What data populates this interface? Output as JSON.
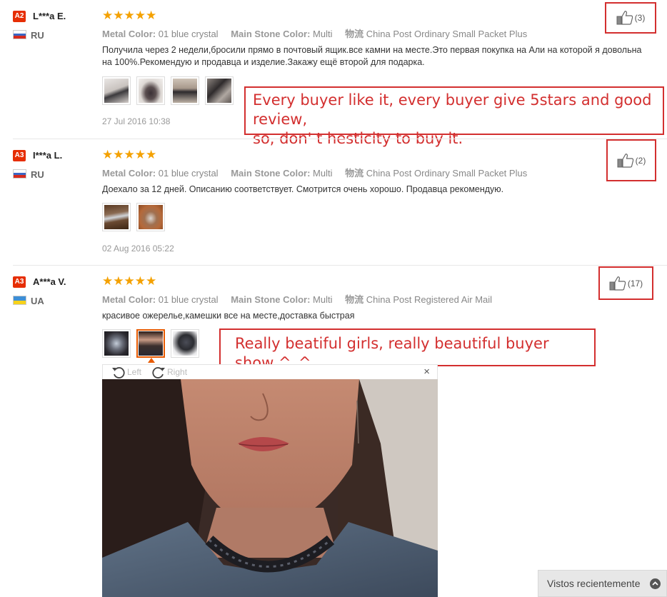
{
  "reviews": [
    {
      "level": "A2",
      "name": "L***a E.",
      "country": "RU",
      "stars": "★★★★★",
      "metal_label": "Metal Color:",
      "metal_value": "01 blue crystal",
      "stone_label": "Main Stone Color:",
      "stone_value": "Multi",
      "ship_label": "物流",
      "ship_value": "China Post Ordinary Small Packet Plus",
      "text": "Получила через 2 недели,бросили прямо в почтовый ящик.все камни на месте.Это первая покупка на Али на которой я довольна на 100%.Рекомендую и продавца и изделие.Закажу ещё второй для подарка.",
      "date": "27 Jul 2016 10:38",
      "likes": "(3)"
    },
    {
      "level": "A3",
      "name": "I***a L.",
      "country": "RU",
      "stars": "★★★★★",
      "metal_label": "Metal Color:",
      "metal_value": "01 blue crystal",
      "stone_label": "Main Stone Color:",
      "stone_value": "Multi",
      "ship_label": "物流",
      "ship_value": "China Post Ordinary Small Packet Plus",
      "text": "Доехало за 12 дней. Описанию соответствует. Смотрится очень хорошо. Продавца рекомендую.",
      "date": "02 Aug 2016 05:22",
      "likes": "(2)"
    },
    {
      "level": "A3",
      "name": "A***a V.",
      "country": "UA",
      "stars": "★★★★★",
      "metal_label": "Metal Color:",
      "metal_value": "01 blue crystal",
      "stone_label": "Main Stone Color:",
      "stone_value": "Multi",
      "ship_label": "物流",
      "ship_value": "China Post Registered Air Mail",
      "text": "красивое ожерелье,камешки все на месте,доставка быстрая",
      "likes": "(17)"
    }
  ],
  "callouts": {
    "first_line1": "Every buyer like it, every buyer give 5stars and good review,",
    "first_line2": "so, don' t hesticity to buy it.",
    "second": "Really beatiful girls, really beautiful buyer show ^_^"
  },
  "viewer": {
    "left_label": "Left",
    "right_label": "Right",
    "close": "×"
  },
  "recent": {
    "label": "Vistos recientemente"
  },
  "colors": {
    "accent": "#e62e04",
    "star": "#f4a100",
    "annotation": "#d32f2f",
    "active_thumb": "#e85a00"
  }
}
